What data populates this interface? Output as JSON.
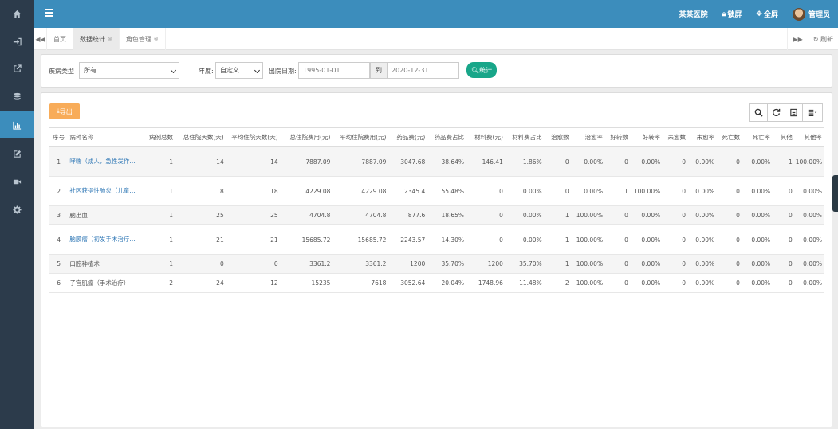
{
  "sidebar": {
    "icons": [
      {
        "name": "home-icon",
        "active": false
      },
      {
        "name": "sign-in-icon",
        "active": false
      },
      {
        "name": "external-link-icon",
        "active": false
      },
      {
        "name": "database-icon",
        "active": false
      },
      {
        "name": "bar-chart-icon",
        "active": true
      },
      {
        "name": "edit-icon",
        "active": false
      },
      {
        "name": "video-icon",
        "active": false
      },
      {
        "name": "gear-icon",
        "active": false
      }
    ]
  },
  "header": {
    "hospital": "某某医院",
    "lock_label": "锁屏",
    "fullscreen_label": "全屏",
    "user": "管理员",
    "color": "#3c8dbc"
  },
  "tabs": {
    "items": [
      {
        "label": "首页",
        "closable": false,
        "active": false
      },
      {
        "label": "数据统计",
        "closable": true,
        "active": true
      },
      {
        "label": "角色管理",
        "closable": true,
        "active": false
      }
    ],
    "refresh_label": "刷新"
  },
  "filters": {
    "disease_type_label": "疾病类型",
    "disease_type_value": "所有",
    "year_label": "年度:",
    "year_value": "自定义",
    "discharge_date_label": "出院日期:",
    "date_from": "1995-01-01",
    "to_label": "到",
    "date_to": "2020-12-31",
    "stat_button": "统计"
  },
  "table": {
    "export_label": "导出",
    "columns": [
      "序号",
      "病种名称",
      "病例总数",
      "总住院天数(天)",
      "平均住院天数(天)",
      "总住院费用(元)",
      "平均住院费用(元)",
      "药品费(元)",
      "药品费占比",
      "材料费(元)",
      "材料费占比",
      "治愈数",
      "治愈率",
      "好转数",
      "好转率",
      "未愈数",
      "未愈率",
      "死亡数",
      "死亡率",
      "其他",
      "其他率"
    ],
    "rows": [
      {
        "cells": [
          "1",
          "哮喘（成人，急性发作…",
          "1",
          "14",
          "14",
          "7887.09",
          "7887.09",
          "3047.68",
          "38.64%",
          "146.41",
          "1.86%",
          "0",
          "0.00%",
          "0",
          "0.00%",
          "0",
          "0.00%",
          "0",
          "0.00%",
          "1",
          "100.00%"
        ],
        "link": true
      },
      {
        "cells": [
          "2",
          "社区获得性肺炎（儿童…",
          "1",
          "18",
          "18",
          "4229.08",
          "4229.08",
          "2345.4",
          "55.48%",
          "0",
          "0.00%",
          "0",
          "0.00%",
          "1",
          "100.00%",
          "0",
          "0.00%",
          "0",
          "0.00%",
          "0",
          "0.00%"
        ],
        "link": true
      },
      {
        "cells": [
          "3",
          "脑出血",
          "1",
          "25",
          "25",
          "4704.8",
          "4704.8",
          "877.6",
          "18.65%",
          "0",
          "0.00%",
          "1",
          "100.00%",
          "0",
          "0.00%",
          "0",
          "0.00%",
          "0",
          "0.00%",
          "0",
          "0.00%"
        ],
        "link": false
      },
      {
        "cells": [
          "4",
          "脑膜瘤（初发手术治疗…",
          "1",
          "21",
          "21",
          "15685.72",
          "15685.72",
          "2243.57",
          "14.30%",
          "0",
          "0.00%",
          "1",
          "100.00%",
          "0",
          "0.00%",
          "0",
          "0.00%",
          "0",
          "0.00%",
          "0",
          "0.00%"
        ],
        "link": true
      },
      {
        "cells": [
          "5",
          "口腔种植术",
          "1",
          "0",
          "0",
          "3361.2",
          "3361.2",
          "1200",
          "35.70%",
          "1200",
          "35.70%",
          "1",
          "100.00%",
          "0",
          "0.00%",
          "0",
          "0.00%",
          "0",
          "0.00%",
          "0",
          "0.00%"
        ],
        "link": false
      },
      {
        "cells": [
          "6",
          "子宫肌瘤（手术治疗）",
          "2",
          "24",
          "12",
          "15235",
          "7618",
          "3052.64",
          "20.04%",
          "1748.96",
          "11.48%",
          "2",
          "100.00%",
          "0",
          "0.00%",
          "0",
          "0.00%",
          "0",
          "0.00%",
          "0",
          "0.00%"
        ],
        "link": false
      }
    ]
  }
}
